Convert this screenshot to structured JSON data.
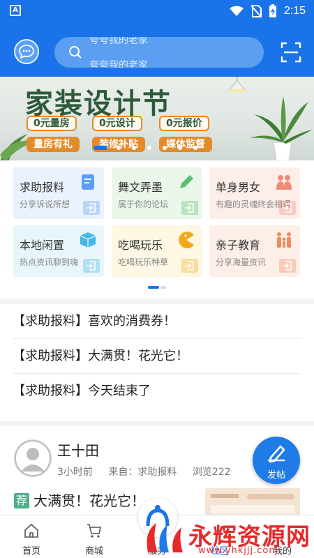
{
  "status_bar": {
    "app_badge": "A",
    "time": "2:15"
  },
  "header": {
    "search_placeholder_top": "夸夸我的老家",
    "search_placeholder_bottom": "夸夸我的老家"
  },
  "banner": {
    "title": "家装设计节",
    "chips_row1": [
      "0元量房",
      "0元设计",
      "0元报价"
    ],
    "chips_row2": [
      "量房有礼",
      "装修补贴",
      "媒体监督"
    ],
    "slide_count": 7,
    "active_slide": 0
  },
  "categories": [
    {
      "title": "求助报料",
      "subtitle": "分享诉说所想",
      "bg": "#eaf3fd",
      "icon": "document-icon",
      "icon_color": "#5b9ef2"
    },
    {
      "title": "舞文弄墨",
      "subtitle": "属于你的论坛",
      "bg": "#eaf6ea",
      "icon": "pencil-icon",
      "icon_color": "#5cc06e"
    },
    {
      "title": "单身男女",
      "subtitle": "有趣的灵魂终会相遇",
      "bg": "#fdeeea",
      "icon": "couple-icon",
      "icon_color": "#f08a78"
    },
    {
      "title": "本地闲置",
      "subtitle": "热点资讯聊到嗨",
      "bg": "#e8f6fc",
      "icon": "box-icon",
      "icon_color": "#45b6e6"
    },
    {
      "title": "吃喝玩乐",
      "subtitle": "吃喝玩乐种草",
      "bg": "#fdf7e3",
      "icon": "pacman-icon",
      "icon_color": "#f3a81b"
    },
    {
      "title": "亲子教育",
      "subtitle": "分享海量资讯",
      "bg": "#fdefe8",
      "icon": "family-icon",
      "icon_color": "#f08a5c"
    }
  ],
  "notices": [
    "【求助报料】喜欢的消费券！",
    "【求助报料】大满贯！花光它！",
    "【求助报料】今天结束了"
  ],
  "post": {
    "author": "王十田",
    "time_ago": "3小时前",
    "source": "来自：求助报料",
    "views": "浏览222",
    "badge": "荐",
    "title": "大满贯！花光它！"
  },
  "fab": {
    "label": "发帖"
  },
  "bottom_nav": [
    {
      "label": "首页",
      "icon": "home-icon"
    },
    {
      "label": "商城",
      "icon": "cart-icon"
    },
    {
      "label": "服务",
      "icon": "service-icon"
    },
    {
      "label": "社区",
      "icon": "community-icon",
      "active": true
    },
    {
      "label": "我的",
      "icon": "profile-icon"
    }
  ],
  "watermark": {
    "text": "永辉资源网",
    "url": "www.yhkjjj.com"
  },
  "colors": {
    "primary": "#1a73e8",
    "accent": "#e28b2b",
    "recommend": "#4cb089"
  }
}
